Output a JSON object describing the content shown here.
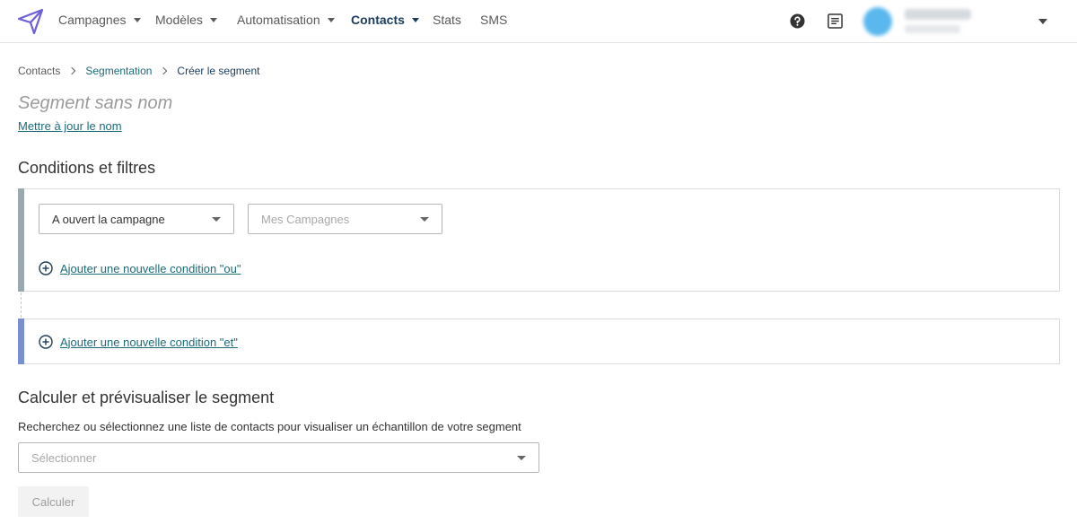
{
  "nav": {
    "items": [
      {
        "label": "Campagnes",
        "has_caret": true
      },
      {
        "label": "Modèles",
        "has_caret": true
      },
      {
        "label": "Automatisation",
        "has_caret": true
      },
      {
        "label": "Contacts",
        "has_caret": true,
        "active": true
      },
      {
        "label": "Stats",
        "has_caret": false
      },
      {
        "label": "SMS",
        "has_caret": false
      }
    ],
    "icons": [
      "paper-plane-logo-icon",
      "help-icon",
      "notes-icon",
      "chevron-down-icon"
    ]
  },
  "breadcrumb": {
    "items": [
      "Contacts",
      "Segmentation",
      "Créer le segment"
    ]
  },
  "segment": {
    "title": "Segment sans nom",
    "rename_link": "Mettre à jour le nom"
  },
  "conditions": {
    "title": "Conditions et filtres",
    "condition_select": "A ouvert la campagne",
    "campaign_placeholder": "Mes Campagnes",
    "add_or": "Ajouter une nouvelle condition \"ou\"",
    "add_and": "Ajouter une nouvelle condition \"et\""
  },
  "preview": {
    "title": "Calculer et prévisualiser le segment",
    "description": "Recherchez ou sélectionnez une liste de contacts pour visualiser un échantillon de votre segment",
    "select_placeholder": "Sélectionner",
    "calc_button": "Calculer"
  },
  "colors": {
    "accent": "#1b6b78",
    "nav_active": "#1a3c5a",
    "or_bar": "#9aa9ad",
    "and_bar": "#7a8fcf",
    "logo": "#6d5fd6"
  }
}
